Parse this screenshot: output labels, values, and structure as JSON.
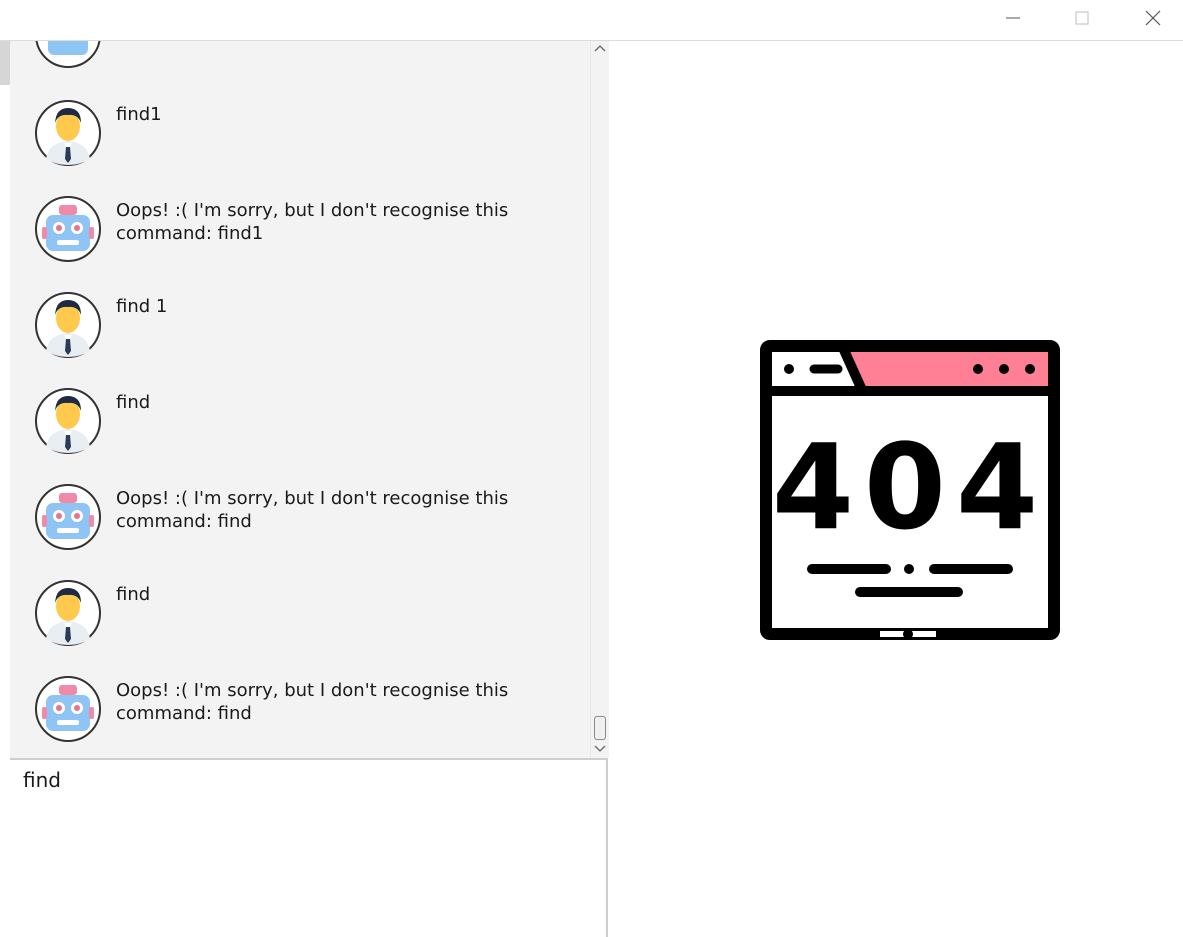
{
  "window": {
    "controls": [
      "minimize",
      "maximize",
      "close"
    ]
  },
  "chat": {
    "messages": [
      {
        "sender": "user",
        "avatar": "user-avatar-icon",
        "text": "find1"
      },
      {
        "sender": "bot",
        "avatar": "robot-avatar-icon",
        "text": "Oops! :( I'm sorry, but I don't recognise this command: find1"
      },
      {
        "sender": "user",
        "avatar": "user-avatar-icon",
        "text": "find 1"
      },
      {
        "sender": "user",
        "avatar": "user-avatar-icon",
        "text": "find"
      },
      {
        "sender": "bot",
        "avatar": "robot-avatar-icon",
        "text": "Oops! :( I'm sorry, but I don't recognise this command: find"
      },
      {
        "sender": "user",
        "avatar": "user-avatar-icon",
        "text": "find"
      },
      {
        "sender": "bot",
        "avatar": "robot-avatar-icon",
        "text": "Oops! :( I'm sorry, but I don't recognise this command: find"
      }
    ]
  },
  "input": {
    "value": "find"
  },
  "error_image": {
    "icon": "error-404-icon",
    "code": "404",
    "accent_color": "#ff8095"
  },
  "colors": {
    "chat_bg": "#f3f3f3",
    "avatar_skin": "#ffc94d",
    "robot_body": "#8ec5f5",
    "robot_accent": "#ef8aa8"
  }
}
